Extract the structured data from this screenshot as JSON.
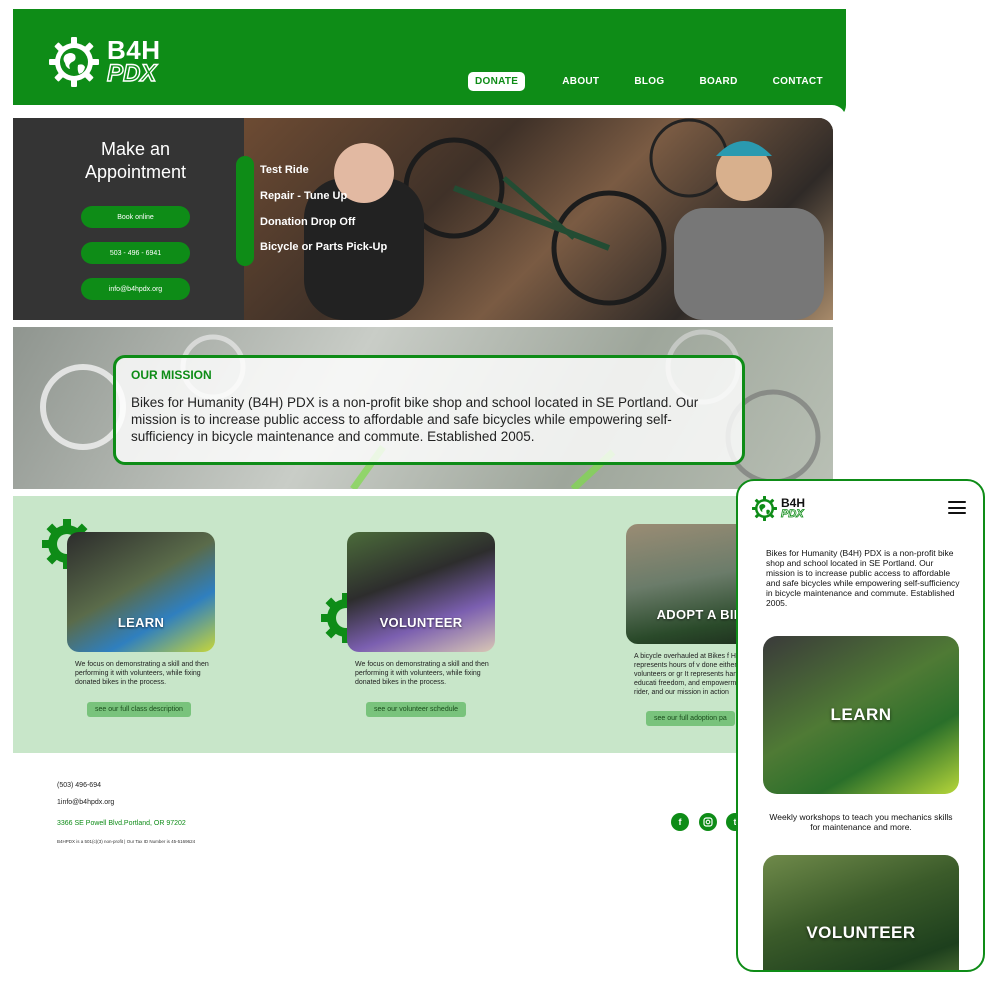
{
  "brand": {
    "line1": "B4H",
    "line2": "PDX"
  },
  "nav": {
    "donate": "DONATE",
    "items": [
      "ABOUT",
      "BLOG",
      "BOARD",
      "CONTACT"
    ]
  },
  "appointment": {
    "title_line1": "Make an",
    "title_line2": "Appointment",
    "buttons": [
      "Book online",
      "503 - 496 - 6941",
      "info@b4hpdx.org"
    ],
    "services": [
      "Test Ride",
      "Repair - Tune Up",
      "Donation Drop Off",
      "Bicycle or Parts Pick-Up"
    ]
  },
  "mission": {
    "title": "OUR MISSION",
    "text": "Bikes for Humanity (B4H) PDX is a non-profit bike shop and school located in SE Portland. Our mission is to increase public access to affordable and safe bicycles while empowering self-sufficiency in bicycle maintenance and commute. Established 2005."
  },
  "programs": [
    {
      "label": "LEARN",
      "desc": "We focus on demonstrating a skill and then performing it with volunteers, while fixing donated bikes in the process.",
      "button": "see our full class description"
    },
    {
      "label": "VOLUNTEER",
      "desc": "We focus on demonstrating a skill and then performing it with volunteers, while fixing donated bikes in the process.",
      "button": "see our volunteer schedule"
    },
    {
      "label": "ADOPT A BIK",
      "desc": "A bicycle overhauled at Bikes f Humanity represents hours of v done either by volunteers or gr It represents hands-on educati freedom, and empowerment fo rider, and our mission in action",
      "button": "see our full adoption pa"
    }
  ],
  "footer": {
    "phone": "(503) 496-694",
    "email": "1info@b4hpdx.org",
    "address": "3366 SE Powell Blvd.Portland, OR 97202",
    "legal": "B4HPDX is a 501(c)(3) non-profit | Our Tax ID Number is 45-5169624"
  },
  "social": {
    "icons": [
      "facebook-icon",
      "instagram-icon",
      "twitter-icon"
    ]
  },
  "mobile": {
    "text": "Bikes for Humanity (B4H) PDX is a non-profit bike shop and school located in SE Portland. Our mission is to increase public access to affordable and safe bicycles while empowering self-sufficiency in bicycle maintenance and commute. Established 2005.",
    "cards": [
      "LEARN",
      "VOLUNTEER"
    ],
    "caption": "Weekly workshops to teach you mechanics skills for maintenance and more."
  },
  "colors": {
    "brand_green": "#0e8c17",
    "light_green": "#c8e6c9",
    "button_green": "#79c37c",
    "dark_panel": "#343434"
  }
}
